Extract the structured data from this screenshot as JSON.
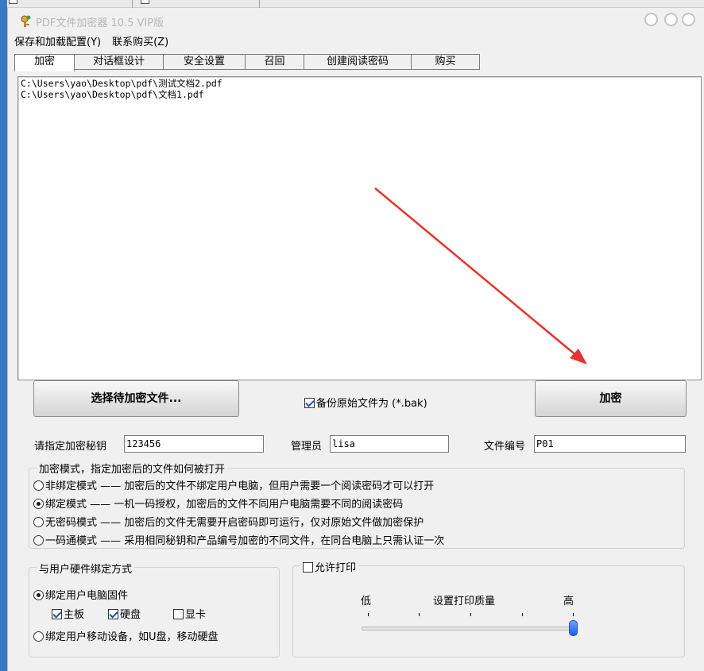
{
  "window": {
    "title": "PDF文件加密器 10.5 VIP版"
  },
  "menu": [
    "保存和加载配置(Y)",
    "联系购买(Z)"
  ],
  "tabs": [
    "加密",
    "对话框设计",
    "安全设置",
    "召回",
    "创建阅读密码",
    "购买"
  ],
  "file_list": [
    "C:\\Users\\yao\\Desktop\\pdf\\测试文档2.pdf",
    "C:\\Users\\yao\\Desktop\\pdf\\文档1.pdf"
  ],
  "buttons": {
    "select_files": "选择待加密文件...",
    "encrypt": "加密"
  },
  "backup": {
    "label": "备份原始文件为 (*.bak)",
    "checked": true
  },
  "fields": {
    "key_label": "请指定加密秘钥",
    "key_value": "123456",
    "admin_label": "管理员",
    "admin_value": "lisa",
    "fileno_label": "文件编号",
    "fileno_value": "P01"
  },
  "encrypt_mode": {
    "legend": "加密模式，指定加密后的文件如何被打开",
    "options": [
      {
        "label": "非绑定模式 —— 加密后的文件不绑定用户电脑，但用户需要一个阅读密码才可以打开",
        "selected": false
      },
      {
        "label": "绑定模式 —— 一机一码授权，加密后的文件不同用户电脑需要不同的阅读密码",
        "selected": true
      },
      {
        "label": "无密码模式 —— 加密后的文件无需要开启密码即可运行，仅对原始文件做加密保护",
        "selected": false
      },
      {
        "label": "一码通模式 —— 采用相同秘钥和产品编号加密的不同文件，在同台电脑上只需认证一次",
        "selected": false
      }
    ]
  },
  "hardware": {
    "legend": "与用户硬件绑定方式",
    "bind_pc": {
      "label": "绑定用户电脑固件",
      "selected": true
    },
    "components": [
      {
        "label": "主板",
        "checked": true
      },
      {
        "label": "硬盘",
        "checked": true
      },
      {
        "label": "显卡",
        "checked": false
      }
    ],
    "bind_mobile": {
      "label": "绑定用户移动设备，如U盘，移动硬盘",
      "selected": false
    }
  },
  "print": {
    "label": "允许打印",
    "checked": false,
    "quality_title": "设置打印质量",
    "low": "低",
    "high": "高",
    "quality_level": 1.0
  },
  "colors": {
    "annotation_arrow": "#e8322c",
    "taskbar": "#3a78c4"
  }
}
